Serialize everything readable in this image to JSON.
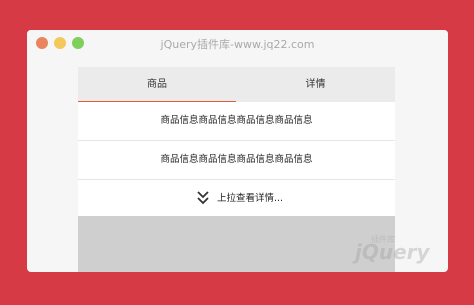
{
  "window": {
    "title": "jQuery插件库-www.jq22.com"
  },
  "tabs": [
    {
      "label": "商品"
    },
    {
      "label": "详情"
    }
  ],
  "rows": [
    {
      "text": "商品信息商品信息商品信息商品信息"
    },
    {
      "text": "商品信息商品信息商品信息商品信息"
    }
  ],
  "more": {
    "label": "上拉查看详情...",
    "icon": "double-chevron-down-icon"
  },
  "watermark": {
    "small_text": "插件库",
    "logo_text": "jQuery"
  },
  "colors": {
    "background": "#d63a44",
    "window": "#f6f6f6",
    "tab_bar": "#ebebeb",
    "tab_active_underline": "#e25a3a",
    "gray_area": "#cfcfcf"
  }
}
